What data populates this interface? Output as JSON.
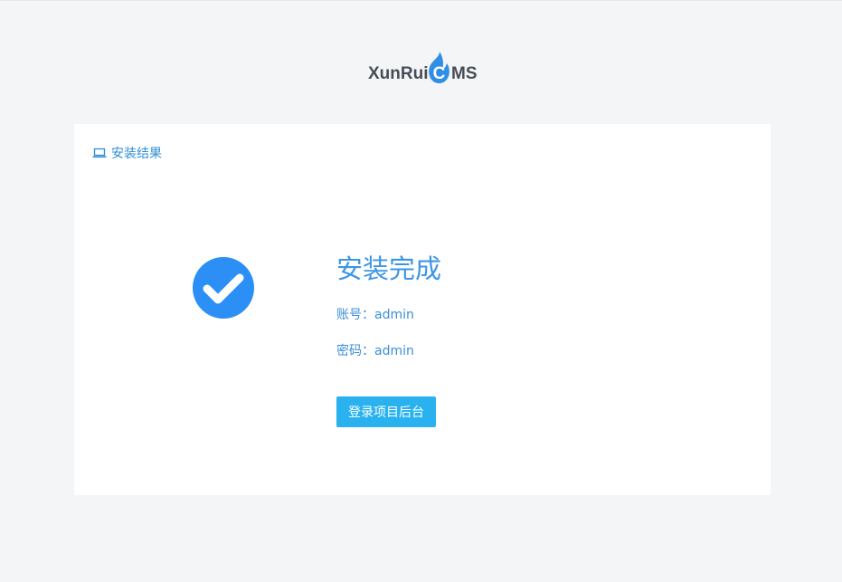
{
  "logo": {
    "text_left": "XunRui",
    "text_center": "C",
    "text_right": "MS",
    "accent_color": "#2f8fe6"
  },
  "card": {
    "heading": "安装结果",
    "heading_icon": "laptop-icon"
  },
  "result": {
    "status_icon": "check-circle-icon",
    "title": "安装完成",
    "account_line": "账号：admin",
    "password_line": "密码：admin",
    "login_button_label": "登录项目后台"
  },
  "colors": {
    "page_background": "#f4f5f7",
    "card_background": "#ffffff",
    "primary_text": "#3c96e6",
    "button_background": "#29b2ef",
    "check_icon": "#2b8ff5"
  }
}
